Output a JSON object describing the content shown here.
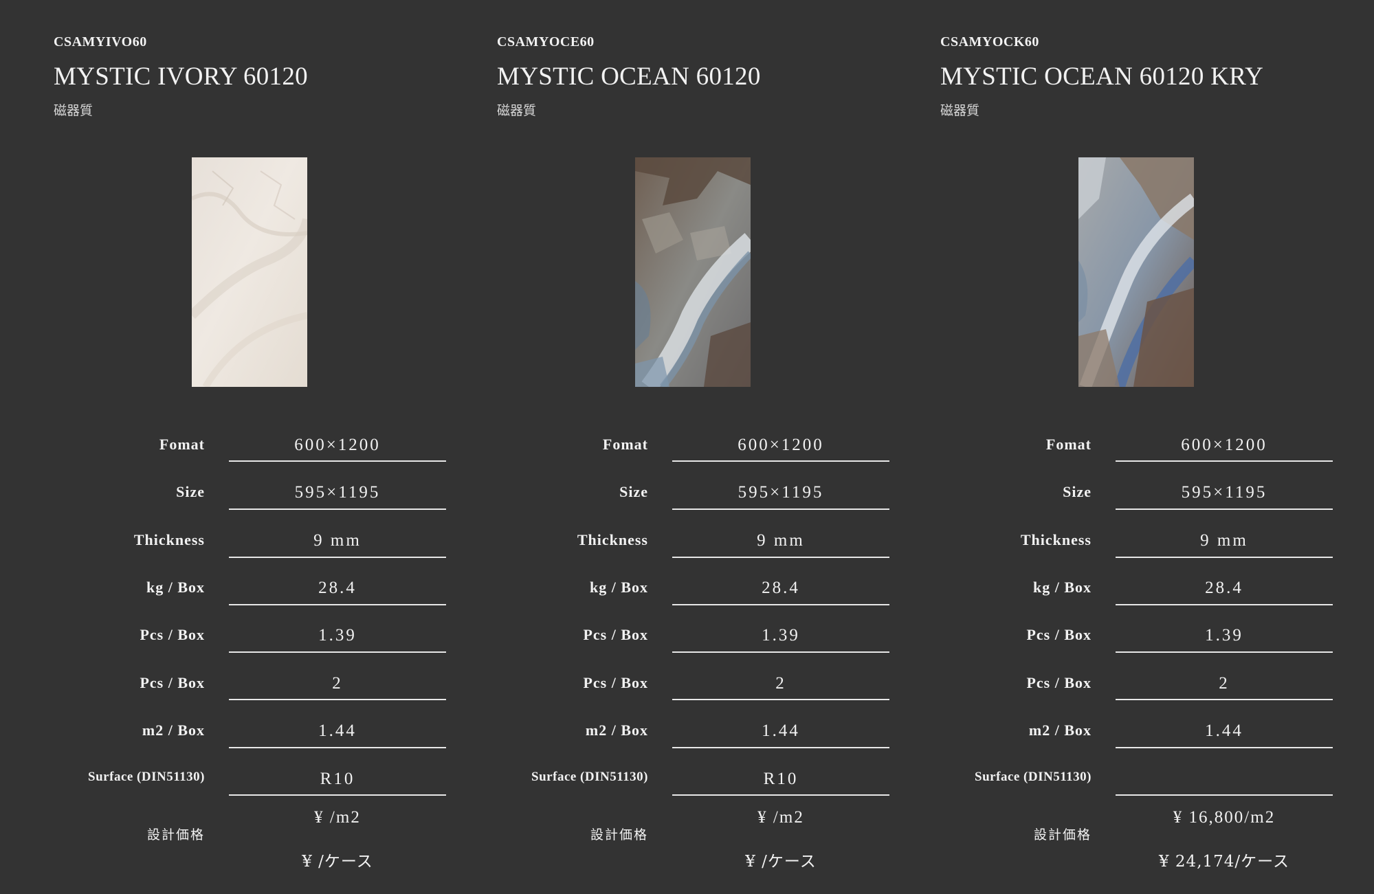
{
  "products": [
    {
      "code": "CSAMYIVO60",
      "name": "MYSTIC IVORY 60120",
      "material": "磁器質",
      "image_style": "ivory marble",
      "specs": [
        {
          "label": "Fomat",
          "value": "600×1200"
        },
        {
          "label": "Size",
          "value": "595×1195"
        },
        {
          "label": "Thickness",
          "value": "9 mm"
        },
        {
          "label": "kg / Box",
          "value": "28.4"
        },
        {
          "label": "Pcs / Box",
          "value": "1.39"
        },
        {
          "label": "Pcs / Box",
          "value": "2"
        },
        {
          "label": "m2 / Box",
          "value": "1.44"
        },
        {
          "label": "Surface (DIN51130)",
          "value": "R10"
        }
      ],
      "price_label": "設計価格",
      "price_m2": "¥ /m2",
      "price_case": "¥ /ケース"
    },
    {
      "code": "CSAMYOCE60",
      "name": "MYSTIC OCEAN 60120",
      "material": "磁器質",
      "image_style": "brown blue marble",
      "specs": [
        {
          "label": "Fomat",
          "value": "600×1200"
        },
        {
          "label": "Size",
          "value": "595×1195"
        },
        {
          "label": "Thickness",
          "value": "9 mm"
        },
        {
          "label": "kg / Box",
          "value": "28.4"
        },
        {
          "label": "Pcs / Box",
          "value": "1.39"
        },
        {
          "label": "Pcs / Box",
          "value": "2"
        },
        {
          "label": "m2 / Box",
          "value": "1.44"
        },
        {
          "label": "Surface (DIN51130)",
          "value": "R10"
        }
      ],
      "price_label": "設計価格",
      "price_m2": "¥ /m2",
      "price_case": "¥ /ケース"
    },
    {
      "code": "CSAMYOCK60",
      "name": "MYSTIC OCEAN 60120 KRY",
      "material": "磁器質",
      "image_style": "blue brown polished marble",
      "specs": [
        {
          "label": "Fomat",
          "value": "600×1200"
        },
        {
          "label": "Size",
          "value": "595×1195"
        },
        {
          "label": "Thickness",
          "value": "9 mm"
        },
        {
          "label": "kg / Box",
          "value": "28.4"
        },
        {
          "label": "Pcs / Box",
          "value": "1.39"
        },
        {
          "label": "Pcs / Box",
          "value": "2"
        },
        {
          "label": "m2 / Box",
          "value": "1.44"
        },
        {
          "label": "Surface (DIN51130)",
          "value": ""
        }
      ],
      "price_label": "設計価格",
      "price_m2": "¥ 16,800/m2",
      "price_case": "¥ 24,174/ケース"
    }
  ],
  "colors": {
    "background": "#333333",
    "text": "#f2f2f2",
    "rule": "#e8e8e8"
  }
}
